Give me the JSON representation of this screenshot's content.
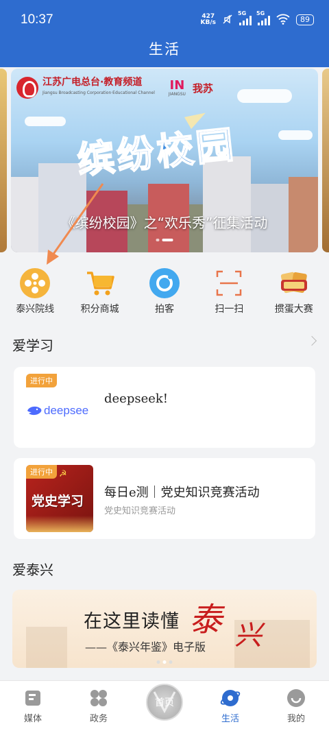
{
  "status_bar": {
    "time": "10:37",
    "net_speed_value": "427",
    "net_speed_unit": "KB/s",
    "sim1_label": "5G",
    "sim2_label": "5G",
    "battery": "89"
  },
  "header": {
    "title": "生活"
  },
  "banner": {
    "logo_text": "江苏广电总台·教育频道",
    "logo_subtext": "Jiangsu Broadcasting Corporation·Educational Channel",
    "partner_logo": "IN",
    "partner_logo_sub": "JIANGSU",
    "partner_name": "我苏",
    "headline_art": "缤纷校园",
    "caption": "《缤纷校园》之“欢乐秀”征集活动",
    "slide_count": 2,
    "active_slide": 1
  },
  "quick_links": [
    {
      "label": "泰兴院线",
      "icon": "film-reel-icon"
    },
    {
      "label": "积分商城",
      "icon": "shopping-cart-icon"
    },
    {
      "label": "拍客",
      "icon": "camera-circle-icon"
    },
    {
      "label": "扫一扫",
      "icon": "scan-icon"
    },
    {
      "label": "掼蛋大赛",
      "icon": "card-game-icon"
    }
  ],
  "learn_section": {
    "title": "爱学习",
    "cards": [
      {
        "tag": "进行中",
        "thumb_text": "deepsee",
        "title": "deepseek!",
        "subtitle": ""
      },
      {
        "tag": "进行中",
        "thumb_text": "党史学习",
        "title": "每日e测｜党史知识竞赛活动",
        "subtitle": "党史知识竞赛活动"
      }
    ]
  },
  "taixing_section": {
    "title": "爱泰兴",
    "banner_main": "在这里读懂",
    "banner_red_1": "泰",
    "banner_red_2": "兴",
    "banner_sub": "——《泰兴年鉴》电子版"
  },
  "bottom_nav": [
    {
      "label": "媒体",
      "icon": "media-icon",
      "active": false
    },
    {
      "label": "政务",
      "icon": "government-icon",
      "active": false
    },
    {
      "label": "首页",
      "icon": "home-icon",
      "active": false
    },
    {
      "label": "生活",
      "icon": "life-planet-icon",
      "active": true
    },
    {
      "label": "我的",
      "icon": "profile-icon",
      "active": false
    }
  ],
  "colors": {
    "primary": "#2e6ccf",
    "tag_orange": "#f2a23b",
    "accent_red": "#c81d1d",
    "arrow_orange": "#f08a50"
  }
}
